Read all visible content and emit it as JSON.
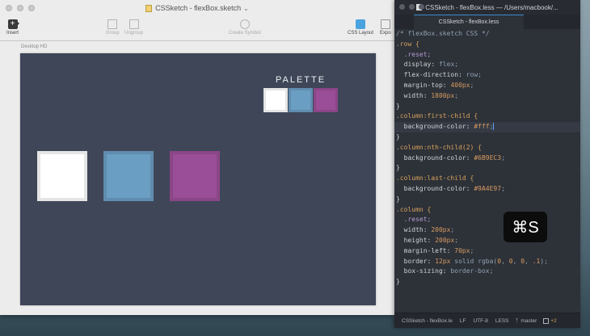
{
  "sketch": {
    "title": "CSSketch - flexBox.sketch",
    "toolbar": {
      "insert": "Insert",
      "group": "Group",
      "ungroup": "Ungroup",
      "create_symbol": "Create Symbol",
      "css_layout": "CSS Layout",
      "export": "Expo"
    },
    "artboard_label": "Desktop HD",
    "artboard_color": "#3F4658",
    "palette": {
      "title": "PALETTE",
      "colors": [
        "#FFFFFF",
        "#6B9EC3",
        "#9A4E97"
      ]
    },
    "columns_colors": [
      "#FFFFFF",
      "#6B9EC3",
      "#9A4E97"
    ]
  },
  "editor": {
    "window_title": "CSSketch - flexBox.less — /Users/macbook/...",
    "tab": "CSSketch - flexBox.less",
    "code_lines": [
      "/* flexBox.sketch CSS */",
      ".row {",
      "  .reset;",
      "  display: flex;",
      "  flex-direction: row;",
      "  margin-top: 400px;",
      "  width: 1800px;",
      "}",
      ".column:first-child {",
      "  background-color: #fff;",
      "}",
      ".column:nth-child(2) {",
      "  background-color: #6B9EC3;",
      "}",
      ".column:last-child {",
      "  background-color: #9A4E97;",
      "}",
      ".column {",
      "  .reset;",
      "  width: 200px;",
      "  height: 200px;",
      "  margin-left: 70px;",
      "  border: 12px solid rgba(0, 0, 0, .1);",
      "  box-sizing: border-box;",
      "}"
    ],
    "status": {
      "file": "CSSketch - flexBox.le",
      "line_ending": "LF",
      "encoding": "UTF-8",
      "grammar": "LESS",
      "branch": "master",
      "changes": "+2"
    }
  },
  "shortcut_overlay": "⌘S"
}
